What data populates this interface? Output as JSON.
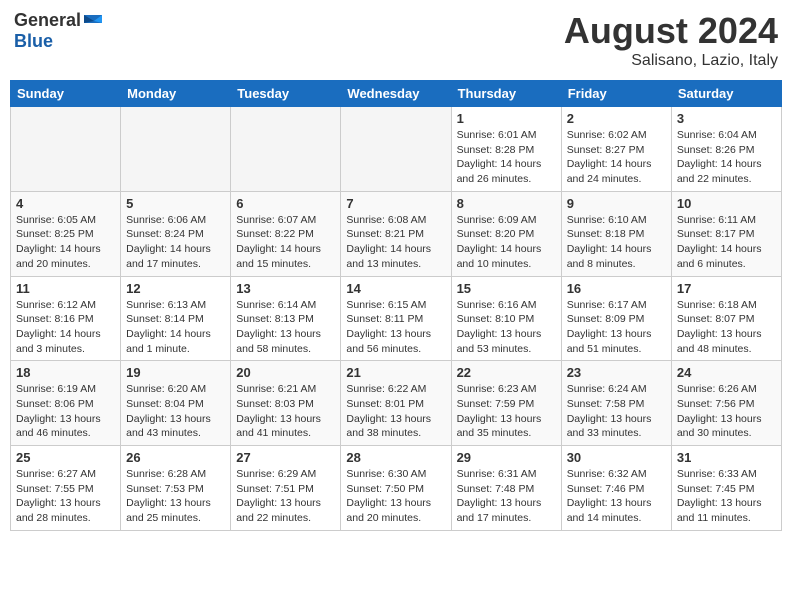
{
  "header": {
    "logo_general": "General",
    "logo_blue": "Blue",
    "title": "August 2024",
    "subtitle": "Salisano, Lazio, Italy"
  },
  "calendar": {
    "days_of_week": [
      "Sunday",
      "Monday",
      "Tuesday",
      "Wednesday",
      "Thursday",
      "Friday",
      "Saturday"
    ],
    "weeks": [
      {
        "shade": "white",
        "days": [
          {
            "num": "",
            "info": "",
            "empty": true
          },
          {
            "num": "",
            "info": "",
            "empty": true
          },
          {
            "num": "",
            "info": "",
            "empty": true
          },
          {
            "num": "",
            "info": "",
            "empty": true
          },
          {
            "num": "1",
            "info": "Sunrise: 6:01 AM\nSunset: 8:28 PM\nDaylight: 14 hours\nand 26 minutes.",
            "empty": false
          },
          {
            "num": "2",
            "info": "Sunrise: 6:02 AM\nSunset: 8:27 PM\nDaylight: 14 hours\nand 24 minutes.",
            "empty": false
          },
          {
            "num": "3",
            "info": "Sunrise: 6:04 AM\nSunset: 8:26 PM\nDaylight: 14 hours\nand 22 minutes.",
            "empty": false
          }
        ]
      },
      {
        "shade": "gray",
        "days": [
          {
            "num": "4",
            "info": "Sunrise: 6:05 AM\nSunset: 8:25 PM\nDaylight: 14 hours\nand 20 minutes.",
            "empty": false
          },
          {
            "num": "5",
            "info": "Sunrise: 6:06 AM\nSunset: 8:24 PM\nDaylight: 14 hours\nand 17 minutes.",
            "empty": false
          },
          {
            "num": "6",
            "info": "Sunrise: 6:07 AM\nSunset: 8:22 PM\nDaylight: 14 hours\nand 15 minutes.",
            "empty": false
          },
          {
            "num": "7",
            "info": "Sunrise: 6:08 AM\nSunset: 8:21 PM\nDaylight: 14 hours\nand 13 minutes.",
            "empty": false
          },
          {
            "num": "8",
            "info": "Sunrise: 6:09 AM\nSunset: 8:20 PM\nDaylight: 14 hours\nand 10 minutes.",
            "empty": false
          },
          {
            "num": "9",
            "info": "Sunrise: 6:10 AM\nSunset: 8:18 PM\nDaylight: 14 hours\nand 8 minutes.",
            "empty": false
          },
          {
            "num": "10",
            "info": "Sunrise: 6:11 AM\nSunset: 8:17 PM\nDaylight: 14 hours\nand 6 minutes.",
            "empty": false
          }
        ]
      },
      {
        "shade": "white",
        "days": [
          {
            "num": "11",
            "info": "Sunrise: 6:12 AM\nSunset: 8:16 PM\nDaylight: 14 hours\nand 3 minutes.",
            "empty": false
          },
          {
            "num": "12",
            "info": "Sunrise: 6:13 AM\nSunset: 8:14 PM\nDaylight: 14 hours\nand 1 minute.",
            "empty": false
          },
          {
            "num": "13",
            "info": "Sunrise: 6:14 AM\nSunset: 8:13 PM\nDaylight: 13 hours\nand 58 minutes.",
            "empty": false
          },
          {
            "num": "14",
            "info": "Sunrise: 6:15 AM\nSunset: 8:11 PM\nDaylight: 13 hours\nand 56 minutes.",
            "empty": false
          },
          {
            "num": "15",
            "info": "Sunrise: 6:16 AM\nSunset: 8:10 PM\nDaylight: 13 hours\nand 53 minutes.",
            "empty": false
          },
          {
            "num": "16",
            "info": "Sunrise: 6:17 AM\nSunset: 8:09 PM\nDaylight: 13 hours\nand 51 minutes.",
            "empty": false
          },
          {
            "num": "17",
            "info": "Sunrise: 6:18 AM\nSunset: 8:07 PM\nDaylight: 13 hours\nand 48 minutes.",
            "empty": false
          }
        ]
      },
      {
        "shade": "gray",
        "days": [
          {
            "num": "18",
            "info": "Sunrise: 6:19 AM\nSunset: 8:06 PM\nDaylight: 13 hours\nand 46 minutes.",
            "empty": false
          },
          {
            "num": "19",
            "info": "Sunrise: 6:20 AM\nSunset: 8:04 PM\nDaylight: 13 hours\nand 43 minutes.",
            "empty": false
          },
          {
            "num": "20",
            "info": "Sunrise: 6:21 AM\nSunset: 8:03 PM\nDaylight: 13 hours\nand 41 minutes.",
            "empty": false
          },
          {
            "num": "21",
            "info": "Sunrise: 6:22 AM\nSunset: 8:01 PM\nDaylight: 13 hours\nand 38 minutes.",
            "empty": false
          },
          {
            "num": "22",
            "info": "Sunrise: 6:23 AM\nSunset: 7:59 PM\nDaylight: 13 hours\nand 35 minutes.",
            "empty": false
          },
          {
            "num": "23",
            "info": "Sunrise: 6:24 AM\nSunset: 7:58 PM\nDaylight: 13 hours\nand 33 minutes.",
            "empty": false
          },
          {
            "num": "24",
            "info": "Sunrise: 6:26 AM\nSunset: 7:56 PM\nDaylight: 13 hours\nand 30 minutes.",
            "empty": false
          }
        ]
      },
      {
        "shade": "white",
        "days": [
          {
            "num": "25",
            "info": "Sunrise: 6:27 AM\nSunset: 7:55 PM\nDaylight: 13 hours\nand 28 minutes.",
            "empty": false
          },
          {
            "num": "26",
            "info": "Sunrise: 6:28 AM\nSunset: 7:53 PM\nDaylight: 13 hours\nand 25 minutes.",
            "empty": false
          },
          {
            "num": "27",
            "info": "Sunrise: 6:29 AM\nSunset: 7:51 PM\nDaylight: 13 hours\nand 22 minutes.",
            "empty": false
          },
          {
            "num": "28",
            "info": "Sunrise: 6:30 AM\nSunset: 7:50 PM\nDaylight: 13 hours\nand 20 minutes.",
            "empty": false
          },
          {
            "num": "29",
            "info": "Sunrise: 6:31 AM\nSunset: 7:48 PM\nDaylight: 13 hours\nand 17 minutes.",
            "empty": false
          },
          {
            "num": "30",
            "info": "Sunrise: 6:32 AM\nSunset: 7:46 PM\nDaylight: 13 hours\nand 14 minutes.",
            "empty": false
          },
          {
            "num": "31",
            "info": "Sunrise: 6:33 AM\nSunset: 7:45 PM\nDaylight: 13 hours\nand 11 minutes.",
            "empty": false
          }
        ]
      }
    ]
  }
}
